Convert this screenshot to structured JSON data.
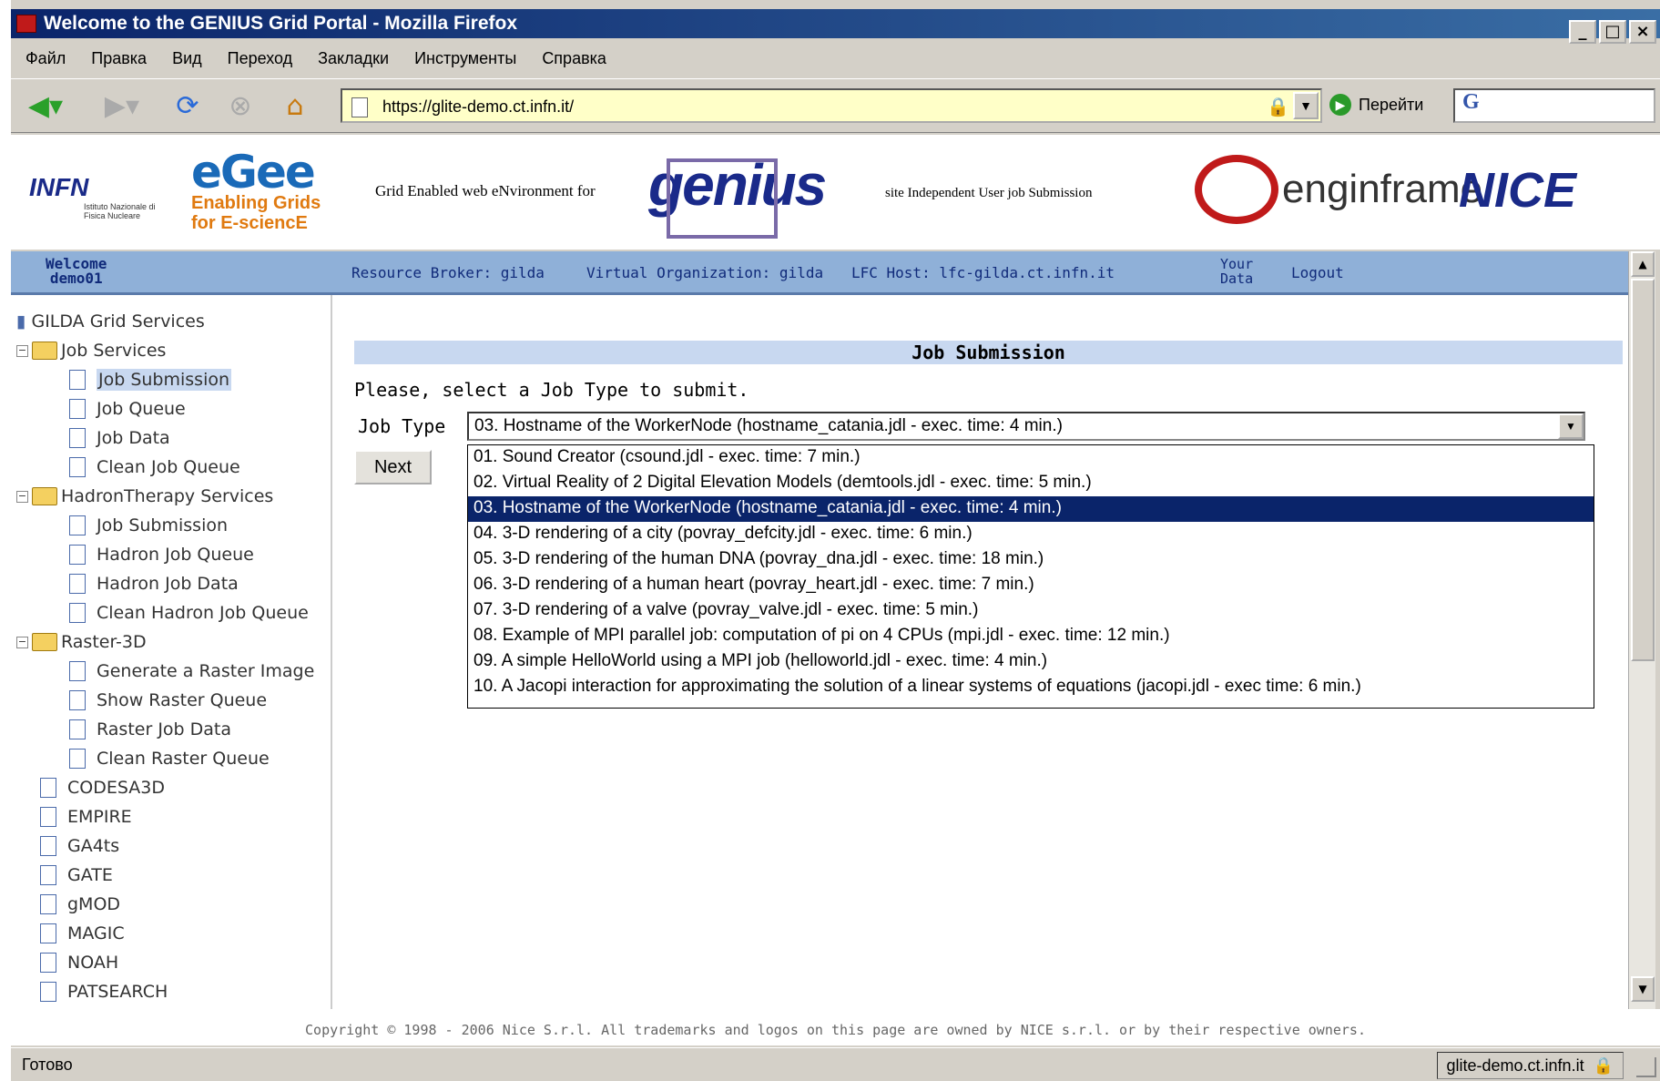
{
  "window": {
    "title": "Welcome to the GENIUS Grid Portal - Mozilla Firefox"
  },
  "menu": [
    "Файл",
    "Правка",
    "Вид",
    "Переход",
    "Закладки",
    "Инструменты",
    "Справка"
  ],
  "nav": {
    "url": "https://glite-demo.ct.infn.it/",
    "go_label": "Перейти",
    "search_icon": "G"
  },
  "banner": {
    "infn": "INFN",
    "infn_sub": "Istituto Nazionale di Fisica Nucleare",
    "egee": "eGee",
    "egee_sub1": "Enabling Grids",
    "egee_sub2": "for E-sciencE",
    "grid_text": "Grid Enabled web eNvironment for",
    "genius": "genius",
    "site_text": "site Independent User job Submission",
    "enginframe": "enginframe",
    "nice": "NICE"
  },
  "welcome": {
    "line1": "Welcome",
    "line2": "demo01",
    "rb": "Resource Broker: gilda",
    "vo": "Virtual Organization: gilda",
    "lfc": "LFC Host: lfc-gilda.ct.infn.it",
    "yd1": "Your",
    "yd2": "Data",
    "logout": "Logout"
  },
  "tree": {
    "root": "GILDA Grid Services",
    "job_services": "Job Services",
    "js_items": [
      "Job Submission",
      "Job Queue",
      "Job Data",
      "Clean Job Queue"
    ],
    "hadron": "HadronTherapy Services",
    "h_items": [
      "Job Submission",
      "Hadron Job Queue",
      "Hadron Job Data",
      "Clean Hadron Job Queue"
    ],
    "raster": "Raster-3D",
    "r_items": [
      "Generate a Raster Image",
      "Show Raster Queue",
      "Raster Job Data",
      "Clean Raster Queue"
    ],
    "apps": [
      "CODESA3D",
      "EMPIRE",
      "GA4ts",
      "GATE",
      "gMOD",
      "MAGIC",
      "NOAH",
      "PATSEARCH"
    ]
  },
  "main": {
    "header": "Job Submission",
    "prompt": "Please, select a Job Type to submit.",
    "job_type_label": "Job Type",
    "selected": "03. Hostname of the WorkerNode (hostname_catania.jdl - exec. time: 4 min.)",
    "next": "Next",
    "options": [
      "01. Sound Creator (csound.jdl - exec. time: 7 min.)",
      "02. Virtual Reality of 2 Digital Elevation Models (demtools.jdl - exec. time: 5 min.)",
      "03. Hostname of the WorkerNode (hostname_catania.jdl - exec. time: 4 min.)",
      "04. 3-D rendering of a city (povray_defcity.jdl - exec. time: 6 min.)",
      "05. 3-D rendering of the human DNA (povray_dna.jdl - exec. time: 18 min.)",
      "06. 3-D rendering of a human heart (povray_heart.jdl - exec. time: 7 min.)",
      "07. 3-D rendering of a valve (povray_valve.jdl - exec. time: 5 min.)",
      "08. Example of MPI parallel job: computation of pi on 4 CPUs (mpi.jdl - exec. time: 12 min.)",
      "09. A simple HelloWorld using a MPI job (helloworld.jdl - exec. time: 4 min.)",
      "10. A Jacopi interaction for approximating the solution of a linear systems of equations (jacopi.jdl - exec time: 6 min.)"
    ]
  },
  "footer": {
    "copyright": "Copyright © 1998 - 2006 Nice S.r.l. All trademarks and logos on this page are owned by NICE s.r.l. or by their respective owners."
  },
  "status": {
    "text": "Готово",
    "host": "glite-demo.ct.infn.it"
  },
  "colors": {
    "titlebar": "#0a246a",
    "highlight": "#0a246a",
    "welcome_bar": "#8fb0d8",
    "header_bar": "#c8d8f0"
  }
}
